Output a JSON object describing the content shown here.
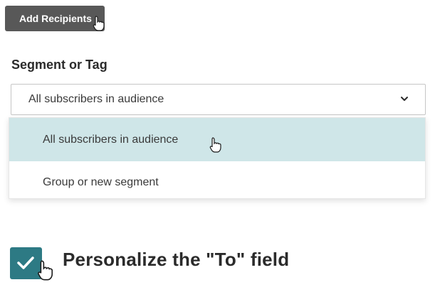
{
  "toolbar": {
    "add_recipients_label": "Add Recipients"
  },
  "segment": {
    "label": "Segment or Tag",
    "selected_value": "All subscribers in audience",
    "options": [
      {
        "label": "All subscribers in audience",
        "highlighted": true
      },
      {
        "label": "Group or new segment",
        "highlighted": false
      }
    ]
  },
  "personalize": {
    "label": "Personalize the \"To\" field",
    "checked": true
  },
  "colors": {
    "button_bg": "#585858",
    "highlight_bg": "#cfe6e8",
    "checkbox_bg": "#2d7a84"
  },
  "icons": {
    "chevron": "chevron-down-icon",
    "cursor": "hand-pointer-icon",
    "checkmark": "checkmark-icon"
  }
}
